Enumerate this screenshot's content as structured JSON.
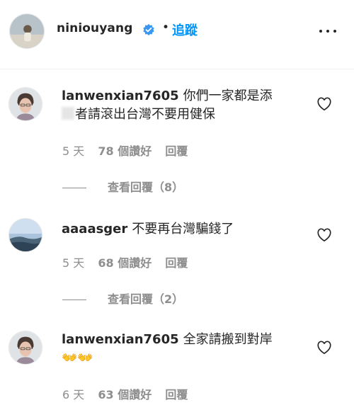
{
  "header": {
    "username": "niniouyang",
    "separator": "•",
    "follow_label": "追蹤",
    "verified_icon": "verified-badge-icon",
    "more_icon": "more-options-icon",
    "accent_color": "#0095f6"
  },
  "comments": [
    {
      "author": "lanwenxian7605",
      "text_line1": "你們一家都是添",
      "text_line2": "者請滾出台灣不要用健保",
      "age": "5 天",
      "likes": "78 個讚好",
      "reply_label": "回覆",
      "view_replies": "查看回覆（8）"
    },
    {
      "author": "aaaasger",
      "text_line1": "不要再台灣騙錢了",
      "age": "5 天",
      "likes": "68 個讚好",
      "reply_label": "回覆",
      "view_replies": "查看回覆（2）"
    },
    {
      "author": "lanwenxian7605",
      "text_line1": "全家請搬到對岸",
      "text_line2": "👐👐",
      "age": "6 天",
      "likes": "63 個讚好",
      "reply_label": "回覆"
    }
  ],
  "colors": {
    "text": "#262626",
    "secondary": "#8e8e8e",
    "divider": "#efefef"
  }
}
